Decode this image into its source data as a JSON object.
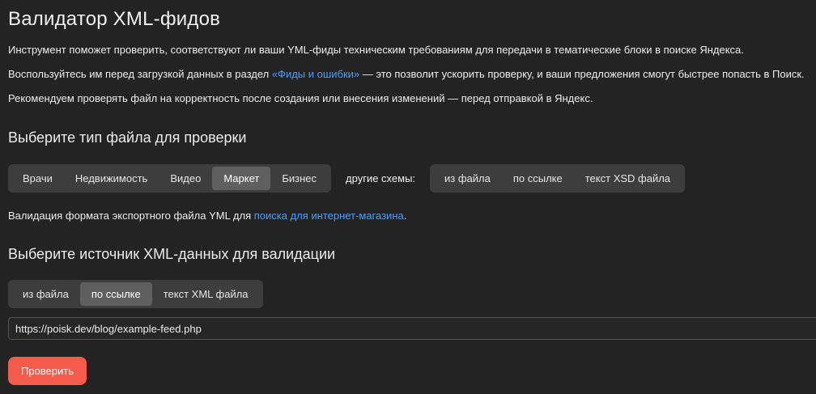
{
  "title": "Валидатор XML-фидов",
  "intro": {
    "line1": "Инструмент поможет проверить, соответствуют ли ваши YML-фиды техническим требованиям для передачи в тематические блоки в поиске Яндекса.",
    "line2_before": "Воспользуйтесь им перед загрузкой данных в раздел ",
    "line2_link": "«Фиды и ошибки»",
    "line2_after": " — это позволит ускорить проверку, и ваши предложения смогут быстрее попасть в Поиск.",
    "line3": "Рекомендуем проверять файл на корректность после создания или внесения изменений — перед отправкой в Яндекс."
  },
  "file_type": {
    "heading": "Выберите тип файла для проверки",
    "options": [
      "Врачи",
      "Недвижимость",
      "Видео",
      "Маркет",
      "Бизнес"
    ],
    "active": "Маркет",
    "other_label": "другие схемы:",
    "other_options": [
      "из файла",
      "по ссылке",
      "текст XSD файла"
    ],
    "hint_before": "Валидация формата экспортного файла YML для ",
    "hint_link": "поиска для интернет-магазина",
    "hint_after": "."
  },
  "source": {
    "heading": "Выберите источник XML-данных для валидации",
    "options": [
      "из файла",
      "по ссылке",
      "текст XML файла"
    ],
    "active": "по ссылке",
    "url_value": "https://poisk.dev/blog/example-feed.php"
  },
  "submit_label": "Проверить",
  "colors": {
    "background": "#232323",
    "link": "#4a9eff",
    "button": "#f45b4b",
    "segment_bg": "#3d3d3d",
    "segment_active": "#5f5f5f"
  }
}
